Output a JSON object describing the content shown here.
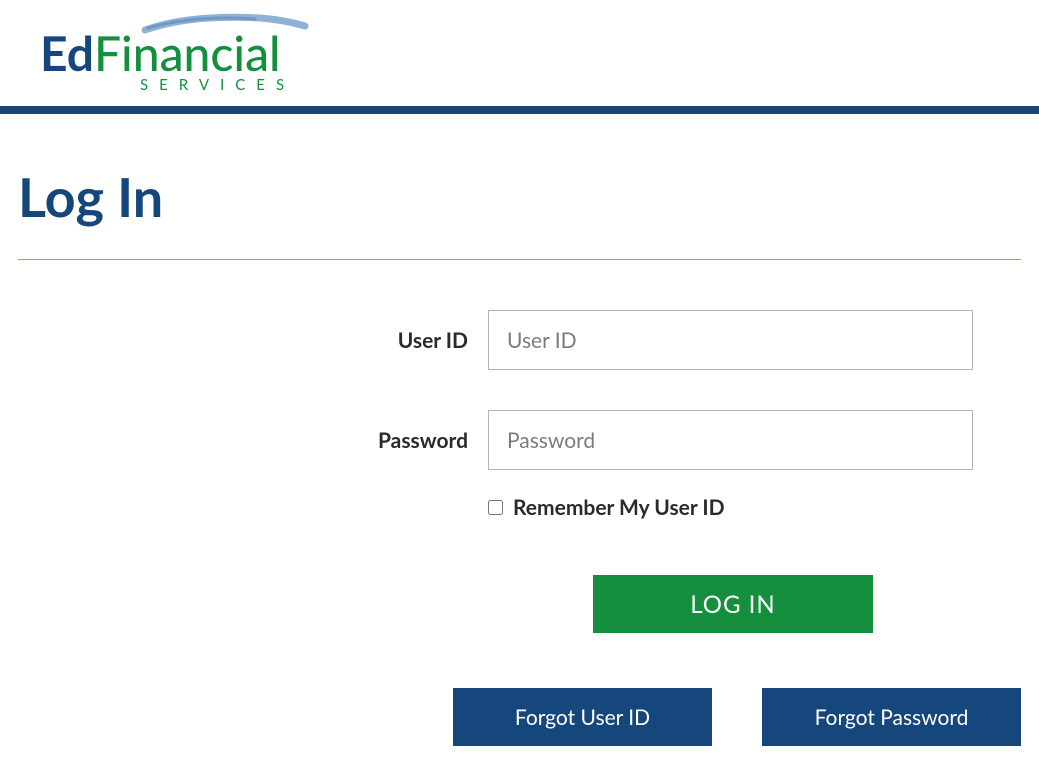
{
  "logo": {
    "part1": "Ed",
    "part2": "Financial",
    "tagline": "SERVICES"
  },
  "page": {
    "title": "Log In"
  },
  "form": {
    "userid_label": "User ID",
    "userid_placeholder": "User ID",
    "userid_value": "",
    "password_label": "Password",
    "password_placeholder": "Password",
    "password_value": "",
    "remember_label": "Remember My User ID"
  },
  "buttons": {
    "login": "LOG IN",
    "forgot_userid": "Forgot User ID",
    "forgot_password": "Forgot Password"
  }
}
